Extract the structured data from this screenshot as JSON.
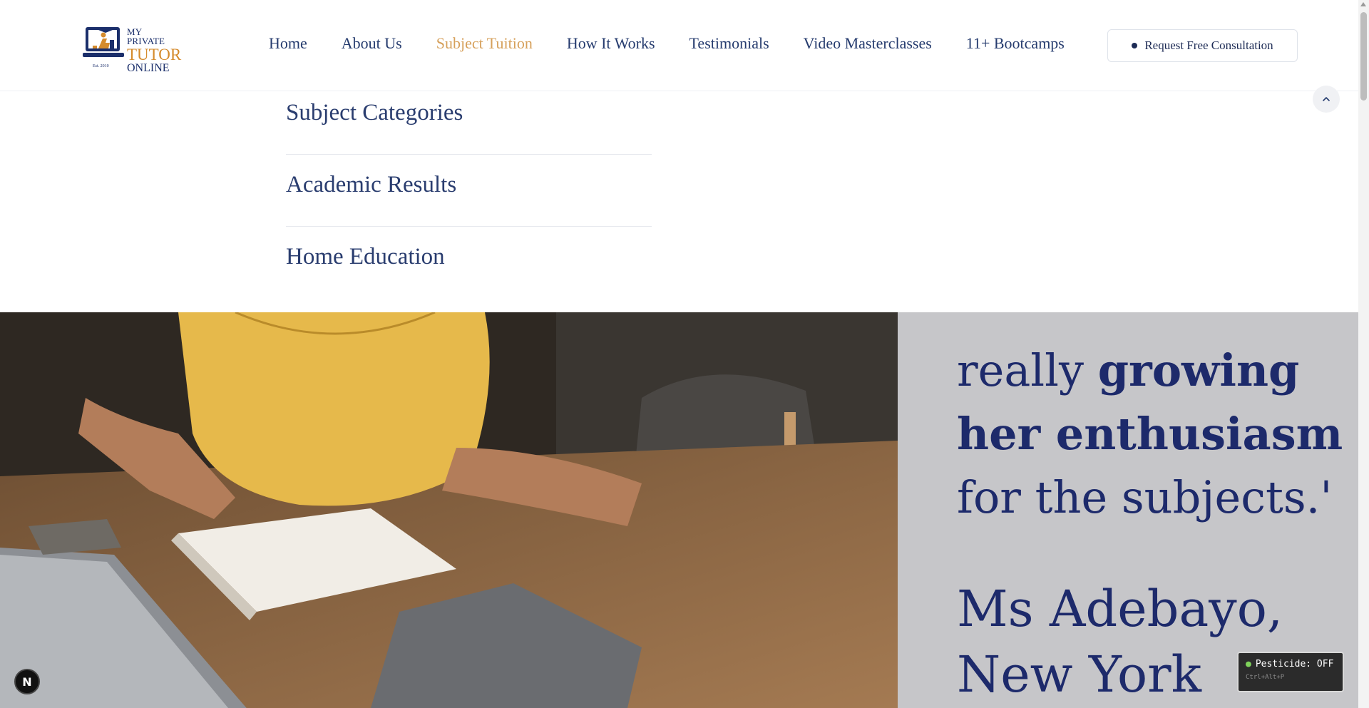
{
  "logo": {
    "line1": "MY PRIVATE",
    "line2": "TUTOR",
    "line3": "ONLINE",
    "est": "Est. 2010"
  },
  "nav": {
    "items": [
      {
        "label": "Home",
        "active": false
      },
      {
        "label": "About Us",
        "active": false
      },
      {
        "label": "Subject Tuition",
        "active": true
      },
      {
        "label": "How It Works",
        "active": false
      },
      {
        "label": "Testimonials",
        "active": false
      },
      {
        "label": "Video Masterclasses",
        "active": false
      },
      {
        "label": "11+ Bootcamps",
        "active": false
      }
    ],
    "cta_label": "Request Free Consultation"
  },
  "dropdown": {
    "items": [
      "Subject Categories",
      "Academic Results",
      "Home Education"
    ]
  },
  "hero": {
    "quote_line1": "really ",
    "quote_line1_bold": "growing",
    "quote_line2_bold": "her enthusiasm",
    "quote_line3": "for the subjects.'",
    "author_line1": "Ms Adebayo,",
    "author_line2": "New York"
  },
  "overlays": {
    "n_badge": "N",
    "pesticide_title": "Pesticide: OFF",
    "pesticide_shortcut": "Ctrl+Alt+P"
  },
  "colors": {
    "brand_navy": "#253b6e",
    "brand_orange": "#d58b2c",
    "nav_active": "#d6a05b",
    "quote_bg": "#c6c6c9",
    "quote_text": "#1d2a6b"
  }
}
